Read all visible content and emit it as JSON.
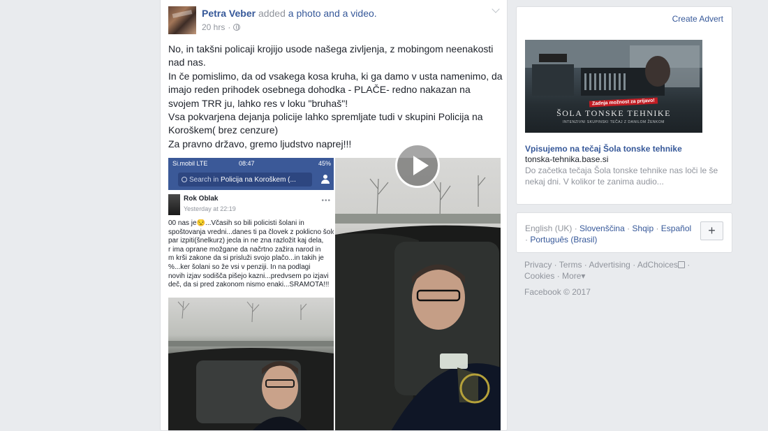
{
  "post": {
    "author": "Petra Veber",
    "action_prefix": "added",
    "action_link": "a photo and a video.",
    "time": "20 hrs",
    "separator": "·",
    "text_lines": [
      "No, in takšni policaji krojijo usode našega zivljenja, z mobingom neenakosti nad nas.",
      "In če pomislimo, da od vsakega kosa kruha, ki ga damo v usta namenimo, da imajo reden prihodek osebnega dohodka - PLAČE- redno nakazan na svojem TRR ju, lahko res v loku \"bruhaš\"!",
      "Vsa pokvarjena dejanja policije lahko spremljate tudi v skupini Policija na Koroškem( brez cenzure)",
      "Za pravno državo, gremo ljudstvo naprej!!!"
    ]
  },
  "screenshot": {
    "carrier": "Si.mobil  LTE",
    "time": "08:47",
    "battery": "45%",
    "search_prefix": "Search in",
    "search_group": "Policija na Koroškem (...",
    "commenter": "Rok Oblak",
    "comment_time": "Yesterday at 22:19",
    "more": "•••",
    "comment_lines": [
      "00 nas je😒...Včasih so bili policisti šolani in",
      "spoštovanja vredni...danes ti pa človek z poklicno šolo",
      "par izpiti(šnelkurz) jecla in ne zna razložit kaj dela,",
      "r ima oprane možgane da načrtno zažira narod in",
      "m krši zakone da si prisluži svojo plačo...in takih je",
      "%...ker šolani so že vsi v penziji. In na podlagi",
      "novih izjav sodišča pišejo kazni...predvsem po izjavi",
      "deč, da si pred zakonom nismo enaki...SRAMOTA!!!"
    ]
  },
  "ad": {
    "create_advert": "Create Advert",
    "image_tag": "Zadnja možnost za prijavo!",
    "image_title": "ŠOLA TONSKE TEHNIKE",
    "image_subtitle": "INTENZIVNI SKUPINSKI TEČAJ Z DANILOM ŽENKOM",
    "title": "Vpisujemo na tečaj Šola tonske tehnike",
    "domain": "tonska-tehnika.base.si",
    "description": "Do začetka tečaja Šola tonske tehnike nas loči le še nekaj dni. V kolikor te zanima audio..."
  },
  "languages": {
    "items": [
      "English (UK)",
      "Slovenščina",
      "Shqip",
      "Español",
      "Português (Brasil)"
    ],
    "sep": " · ",
    "plus": "+"
  },
  "footer": {
    "links": [
      "Privacy",
      "Terms",
      "Advertising",
      "AdChoices",
      "Cookies",
      "More"
    ],
    "more_suffix": "▾",
    "copyright": "Facebook © 2017"
  }
}
